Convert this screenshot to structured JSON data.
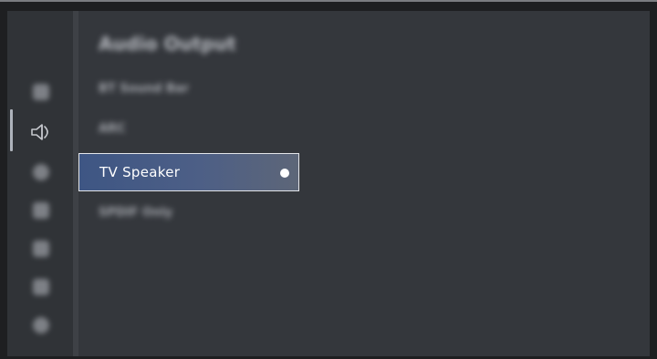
{
  "menu": {
    "title": "Audio Output",
    "options": [
      {
        "label": "BT Sound Bar",
        "selected": false
      },
      {
        "label": "ARC",
        "selected": false
      },
      {
        "label": "TV Speaker",
        "selected": true
      },
      {
        "label": "SPDIF Only",
        "selected": false
      }
    ]
  },
  "sidebar": {
    "icons": [
      "picture-icon",
      "sound-icon",
      "network-icon",
      "channel-icon",
      "accessibility-icon",
      "system-icon",
      "support-icon"
    ],
    "active_icon": "sound-icon"
  },
  "colors": {
    "background": "#34373c",
    "highlight": "#46598a",
    "text": "#ffffff"
  }
}
